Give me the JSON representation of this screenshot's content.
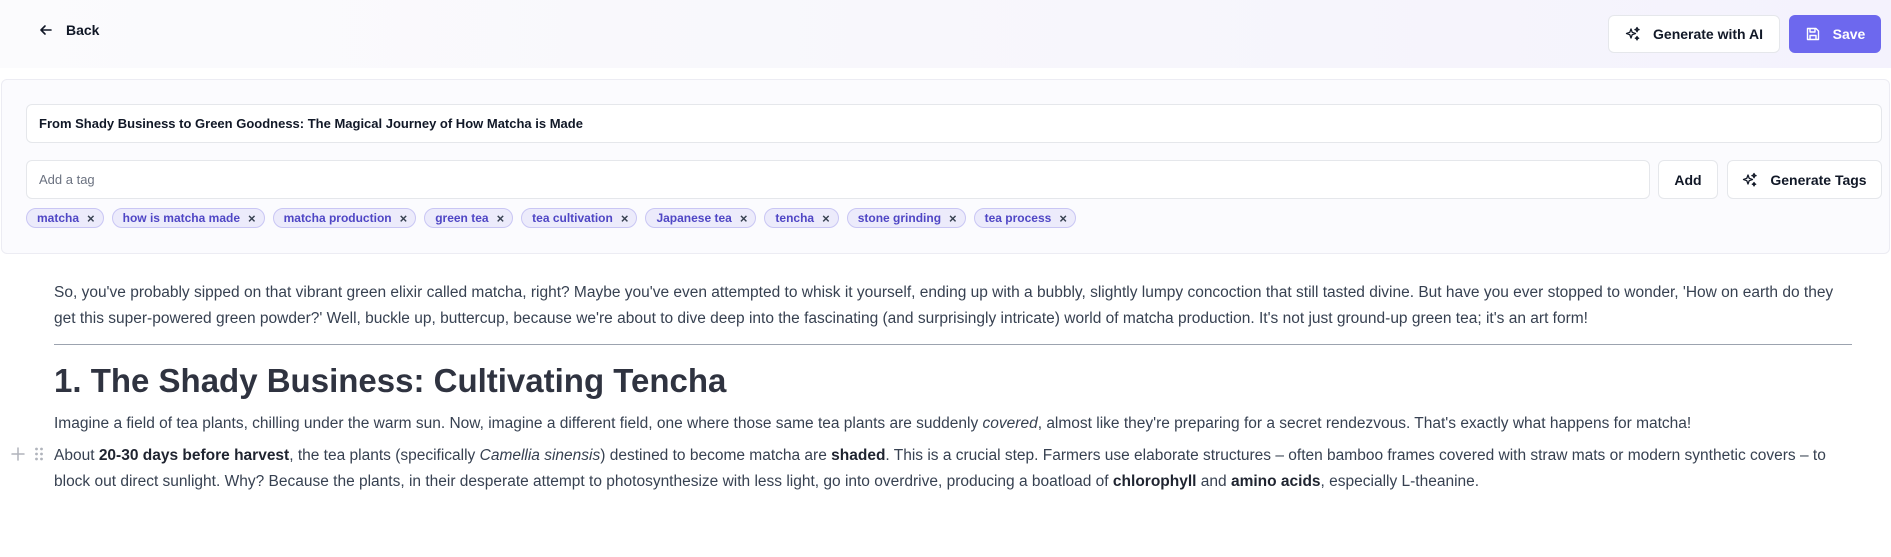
{
  "header": {
    "back_label": "Back",
    "generate_ai_label": "Generate with AI",
    "save_label": "Save"
  },
  "form": {
    "title_value": "From Shady Business to Green Goodness: The Magical Journey of How Matcha is Made",
    "tag_placeholder": "Add a tag",
    "add_label": "Add",
    "generate_tags_label": "Generate Tags",
    "tags": [
      "matcha",
      "how is matcha made",
      "matcha production",
      "green tea",
      "tea cultivation",
      "Japanese tea",
      "tencha",
      "stone grinding",
      "tea process"
    ],
    "tag_remove_glyph": "×"
  },
  "article": {
    "intro": "So, you've probably sipped on that vibrant green elixir called matcha, right? Maybe you've even attempted to whisk it yourself, ending up with a bubbly, slightly lumpy concoction that still tasted divine. But have you ever stopped to wonder, 'How on earth do they get this super-powered green powder?' Well, buckle up, buttercup, because we're about to dive deep into the fascinating (and surprisingly intricate) world of matcha production. It's not just ground-up green tea; it's an art form!",
    "heading": "1. The Shady Business: Cultivating Tencha",
    "p2": {
      "a": "Imagine a field of tea plants, chilling under the warm sun. Now, imagine a different field, one where those same tea plants are suddenly ",
      "em": "covered",
      "b": ", almost like they're preparing for a secret rendezvous. That's exactly what happens for matcha!"
    },
    "p3": {
      "a": "About ",
      "b1": "20-30 days before harvest",
      "c": ", the tea plants (specifically ",
      "em": "Camellia sinensis",
      "d": ") destined to become matcha are ",
      "b2": "shaded",
      "e": ". This is a crucial step. Farmers use elaborate structures – often bamboo frames covered with straw mats or modern synthetic covers – to block out direct sunlight. Why? Because the plants, in their desperate attempt to photosynthesize with less light, go into overdrive, producing a boatload of ",
      "b3": "chlorophyll",
      "f": " and ",
      "b4": "amino acids",
      "g": ", especially L-theanine."
    }
  },
  "icons": {
    "back": "arrow-left-icon",
    "ai": "sparkles-icon",
    "save": "floppy-disk-icon",
    "add_block": "plus-icon",
    "drag": "drag-handle-icon"
  },
  "colors": {
    "accent": "#6d68ee",
    "tag_bg": "#ecebfb",
    "tag_text": "#4f46c5"
  }
}
